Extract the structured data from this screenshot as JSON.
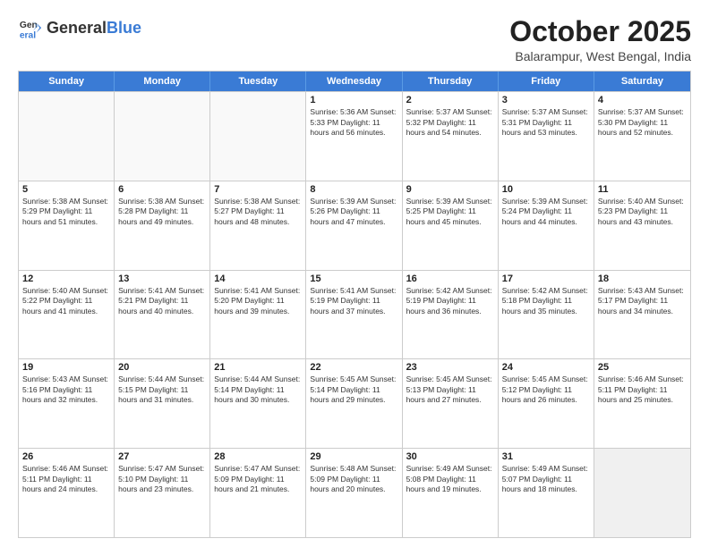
{
  "header": {
    "logo_general": "General",
    "logo_blue": "Blue",
    "month_title": "October 2025",
    "location": "Balarampur, West Bengal, India"
  },
  "days_of_week": [
    "Sunday",
    "Monday",
    "Tuesday",
    "Wednesday",
    "Thursday",
    "Friday",
    "Saturday"
  ],
  "weeks": [
    [
      {
        "day": "",
        "info": ""
      },
      {
        "day": "",
        "info": ""
      },
      {
        "day": "",
        "info": ""
      },
      {
        "day": "1",
        "info": "Sunrise: 5:36 AM\nSunset: 5:33 PM\nDaylight: 11 hours\nand 56 minutes."
      },
      {
        "day": "2",
        "info": "Sunrise: 5:37 AM\nSunset: 5:32 PM\nDaylight: 11 hours\nand 54 minutes."
      },
      {
        "day": "3",
        "info": "Sunrise: 5:37 AM\nSunset: 5:31 PM\nDaylight: 11 hours\nand 53 minutes."
      },
      {
        "day": "4",
        "info": "Sunrise: 5:37 AM\nSunset: 5:30 PM\nDaylight: 11 hours\nand 52 minutes."
      }
    ],
    [
      {
        "day": "5",
        "info": "Sunrise: 5:38 AM\nSunset: 5:29 PM\nDaylight: 11 hours\nand 51 minutes."
      },
      {
        "day": "6",
        "info": "Sunrise: 5:38 AM\nSunset: 5:28 PM\nDaylight: 11 hours\nand 49 minutes."
      },
      {
        "day": "7",
        "info": "Sunrise: 5:38 AM\nSunset: 5:27 PM\nDaylight: 11 hours\nand 48 minutes."
      },
      {
        "day": "8",
        "info": "Sunrise: 5:39 AM\nSunset: 5:26 PM\nDaylight: 11 hours\nand 47 minutes."
      },
      {
        "day": "9",
        "info": "Sunrise: 5:39 AM\nSunset: 5:25 PM\nDaylight: 11 hours\nand 45 minutes."
      },
      {
        "day": "10",
        "info": "Sunrise: 5:39 AM\nSunset: 5:24 PM\nDaylight: 11 hours\nand 44 minutes."
      },
      {
        "day": "11",
        "info": "Sunrise: 5:40 AM\nSunset: 5:23 PM\nDaylight: 11 hours\nand 43 minutes."
      }
    ],
    [
      {
        "day": "12",
        "info": "Sunrise: 5:40 AM\nSunset: 5:22 PM\nDaylight: 11 hours\nand 41 minutes."
      },
      {
        "day": "13",
        "info": "Sunrise: 5:41 AM\nSunset: 5:21 PM\nDaylight: 11 hours\nand 40 minutes."
      },
      {
        "day": "14",
        "info": "Sunrise: 5:41 AM\nSunset: 5:20 PM\nDaylight: 11 hours\nand 39 minutes."
      },
      {
        "day": "15",
        "info": "Sunrise: 5:41 AM\nSunset: 5:19 PM\nDaylight: 11 hours\nand 37 minutes."
      },
      {
        "day": "16",
        "info": "Sunrise: 5:42 AM\nSunset: 5:19 PM\nDaylight: 11 hours\nand 36 minutes."
      },
      {
        "day": "17",
        "info": "Sunrise: 5:42 AM\nSunset: 5:18 PM\nDaylight: 11 hours\nand 35 minutes."
      },
      {
        "day": "18",
        "info": "Sunrise: 5:43 AM\nSunset: 5:17 PM\nDaylight: 11 hours\nand 34 minutes."
      }
    ],
    [
      {
        "day": "19",
        "info": "Sunrise: 5:43 AM\nSunset: 5:16 PM\nDaylight: 11 hours\nand 32 minutes."
      },
      {
        "day": "20",
        "info": "Sunrise: 5:44 AM\nSunset: 5:15 PM\nDaylight: 11 hours\nand 31 minutes."
      },
      {
        "day": "21",
        "info": "Sunrise: 5:44 AM\nSunset: 5:14 PM\nDaylight: 11 hours\nand 30 minutes."
      },
      {
        "day": "22",
        "info": "Sunrise: 5:45 AM\nSunset: 5:14 PM\nDaylight: 11 hours\nand 29 minutes."
      },
      {
        "day": "23",
        "info": "Sunrise: 5:45 AM\nSunset: 5:13 PM\nDaylight: 11 hours\nand 27 minutes."
      },
      {
        "day": "24",
        "info": "Sunrise: 5:45 AM\nSunset: 5:12 PM\nDaylight: 11 hours\nand 26 minutes."
      },
      {
        "day": "25",
        "info": "Sunrise: 5:46 AM\nSunset: 5:11 PM\nDaylight: 11 hours\nand 25 minutes."
      }
    ],
    [
      {
        "day": "26",
        "info": "Sunrise: 5:46 AM\nSunset: 5:11 PM\nDaylight: 11 hours\nand 24 minutes."
      },
      {
        "day": "27",
        "info": "Sunrise: 5:47 AM\nSunset: 5:10 PM\nDaylight: 11 hours\nand 23 minutes."
      },
      {
        "day": "28",
        "info": "Sunrise: 5:47 AM\nSunset: 5:09 PM\nDaylight: 11 hours\nand 21 minutes."
      },
      {
        "day": "29",
        "info": "Sunrise: 5:48 AM\nSunset: 5:09 PM\nDaylight: 11 hours\nand 20 minutes."
      },
      {
        "day": "30",
        "info": "Sunrise: 5:49 AM\nSunset: 5:08 PM\nDaylight: 11 hours\nand 19 minutes."
      },
      {
        "day": "31",
        "info": "Sunrise: 5:49 AM\nSunset: 5:07 PM\nDaylight: 11 hours\nand 18 minutes."
      },
      {
        "day": "",
        "info": ""
      }
    ]
  ]
}
